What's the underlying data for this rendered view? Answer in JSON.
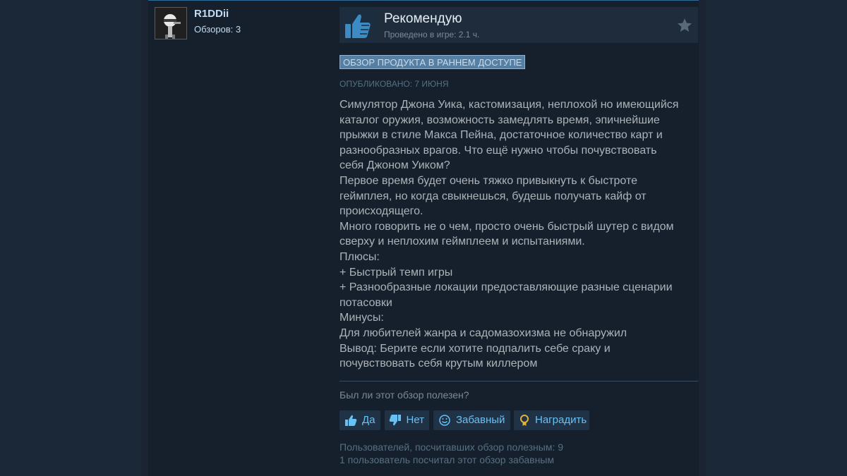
{
  "author": {
    "name": "R1DDii",
    "reviews_label": "Обзоров: 3"
  },
  "review": {
    "verdict": "Рекомендую",
    "hours": "Проведено в игре: 2.1 ч.",
    "early_access_badge": "ОБЗОР ПРОДУКТА В РАННЕМ ДОСТУПЕ",
    "posted": "ОПУБЛИКОВАНО: 7 ИЮНЯ",
    "body_lines": [
      "Симулятор Джона Уика, кастомизация, неплохой но имеющийся",
      "каталог оружия, возможность замедлять время, эпичнейшие",
      "прыжки в стиле Макса Пейна, достаточное количество карт и",
      "разнообразных врагов. Что ещё нужно чтобы почувствовать",
      "себя Джоном Уиком?",
      "Первое время будет очень тяжко привыкнуть к быстроте",
      "геймплея, но когда свыкнешься, будешь получать кайф от",
      "происходящего.",
      "Много говорить не о чем, просто очень быстрый шутер с видом",
      "сверху и неплохим геймплеем и испытаниями.",
      "Плюсы:",
      "+ Быстрый темп игры",
      "+ Разнообразные локации предоставляющие разные сценарии",
      "потасовки",
      "Минусы:",
      "Для любителей жанра и садомазохизма не обнаружил",
      "Вывод: Берите если хотите подпалить себе сраку и",
      "почувствовать себя крутым киллером"
    ]
  },
  "feedback": {
    "question": "Был ли этот обзор полезен?",
    "yes_label": "Да",
    "no_label": "Нет",
    "funny_label": "Забавный",
    "award_label": "Наградить",
    "helpful_count": "Пользователей, посчитавших обзор полезным: 9",
    "funny_count": "1 пользователь посчитал этот обзор забавным"
  },
  "icons": {
    "thumb_up": "thumbs-up-icon",
    "star": "star-icon",
    "smile": "smiley-icon",
    "award": "award-medal-icon"
  },
  "colors": {
    "accent_link": "#67c1f5",
    "thumb_blue": "#3c8bc2"
  }
}
